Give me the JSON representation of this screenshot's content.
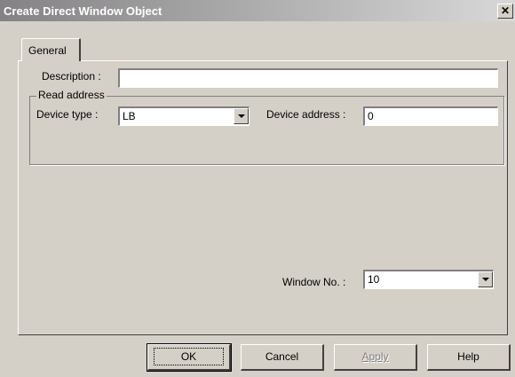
{
  "window": {
    "title": "Create Direct Window Object"
  },
  "tabs": [
    {
      "label": "General"
    }
  ],
  "general": {
    "description": {
      "label": "Description :",
      "value": ""
    },
    "read_address": {
      "group_label": "Read address",
      "device_type": {
        "label": "Device type :",
        "value": "LB"
      },
      "device_address": {
        "label": "Device address :",
        "value": "0"
      }
    },
    "window_no": {
      "label": "Window No. :",
      "value": "10"
    }
  },
  "buttons": {
    "ok": "OK",
    "cancel": "Cancel",
    "apply": "Apply",
    "help": "Help"
  },
  "colors": {
    "title_gradient_start": "#848284",
    "title_gradient_end": "#d8d8d8",
    "face": "#d4d0c8"
  }
}
